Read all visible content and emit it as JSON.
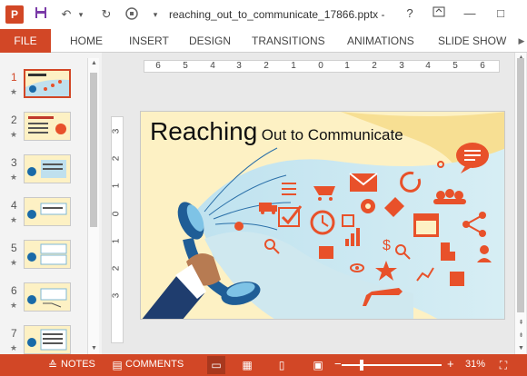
{
  "titlebar": {
    "logo": "P",
    "quick_access": [
      "save-icon",
      "undo-icon",
      "redo-icon",
      "present-icon"
    ],
    "document_title": "reaching_out_to_communicate_17866.pptx -",
    "help": "?",
    "restore": "□",
    "minimize": "—",
    "maximize": "□"
  },
  "ribbon": {
    "tabs": [
      "FILE",
      "HOME",
      "INSERT",
      "DESIGN",
      "TRANSITIONS",
      "ANIMATIONS",
      "SLIDE SHOW"
    ],
    "accent_color": "#d24726"
  },
  "thumbnails": {
    "items": [
      {
        "number": "1",
        "star": "★",
        "active": true
      },
      {
        "number": "2",
        "star": "★",
        "active": false
      },
      {
        "number": "3",
        "star": "★",
        "active": false
      },
      {
        "number": "4",
        "star": "★",
        "active": false
      },
      {
        "number": "5",
        "star": "★",
        "active": false
      },
      {
        "number": "6",
        "star": "★",
        "active": false
      },
      {
        "number": "7",
        "star": "★",
        "active": false
      }
    ]
  },
  "ruler": {
    "horizontal": [
      "6",
      "5",
      "4",
      "3",
      "2",
      "1",
      "0",
      "1",
      "2",
      "3",
      "4",
      "5",
      "6"
    ],
    "vertical": [
      "3",
      "2",
      "1",
      "0",
      "1",
      "2",
      "3"
    ]
  },
  "slide": {
    "title_large": "Reaching",
    "title_small": "Out to Communicate"
  },
  "status": {
    "notes": "NOTES",
    "comments": "COMMENTS",
    "zoom": "31%",
    "zoom_minus": "−",
    "zoom_plus": "+"
  }
}
